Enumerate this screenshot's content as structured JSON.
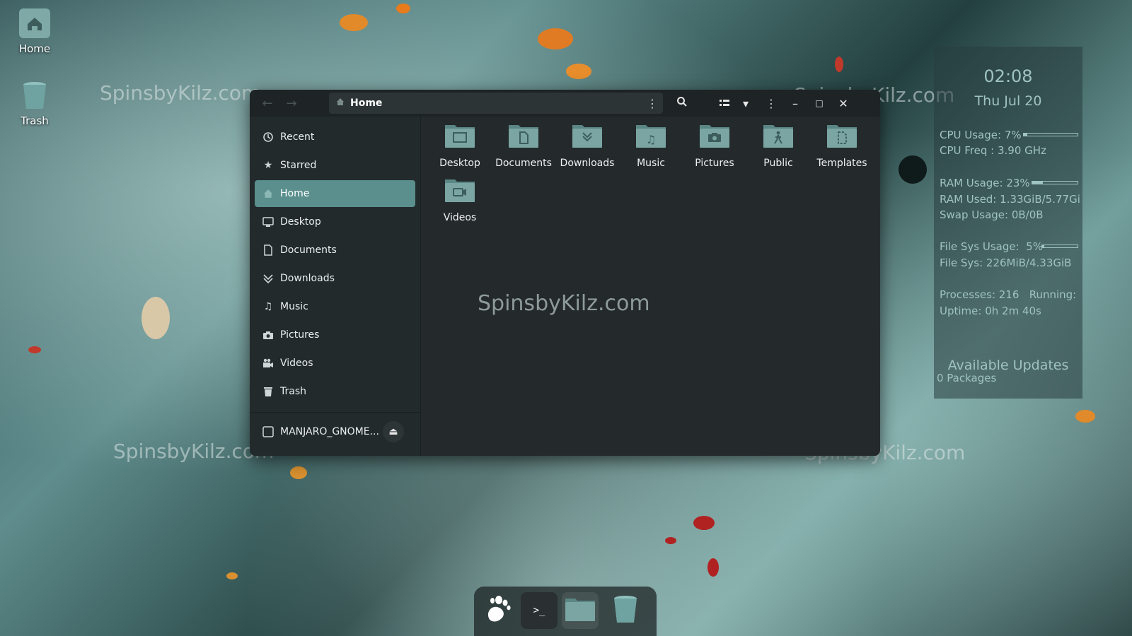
{
  "desktop": {
    "icons": [
      {
        "label": "Home",
        "icon": "home-folder-icon"
      },
      {
        "label": "Trash",
        "icon": "trash-icon"
      }
    ],
    "watermark_text": "SpinsbyKilz.com"
  },
  "file_manager": {
    "path": "Home",
    "sidebar": {
      "items": [
        {
          "label": "Recent",
          "icon": "recent-icon"
        },
        {
          "label": "Starred",
          "icon": "star-icon"
        },
        {
          "label": "Home",
          "icon": "home-icon",
          "active": true
        },
        {
          "label": "Desktop",
          "icon": "desktop-icon"
        },
        {
          "label": "Documents",
          "icon": "documents-icon"
        },
        {
          "label": "Downloads",
          "icon": "downloads-icon"
        },
        {
          "label": "Music",
          "icon": "music-icon"
        },
        {
          "label": "Pictures",
          "icon": "pictures-icon"
        },
        {
          "label": "Videos",
          "icon": "videos-icon"
        },
        {
          "label": "Trash",
          "icon": "trash-icon"
        }
      ],
      "device": {
        "label": "MANJARO_GNOME...",
        "icon": "drive-icon"
      }
    },
    "folders": [
      {
        "label": "Desktop",
        "icon": "desktop-folder-icon"
      },
      {
        "label": "Documents",
        "icon": "documents-folder-icon"
      },
      {
        "label": "Downloads",
        "icon": "downloads-folder-icon"
      },
      {
        "label": "Music",
        "icon": "music-folder-icon"
      },
      {
        "label": "Pictures",
        "icon": "pictures-folder-icon"
      },
      {
        "label": "Public",
        "icon": "public-folder-icon"
      },
      {
        "label": "Templates",
        "icon": "templates-folder-icon"
      },
      {
        "label": "Videos",
        "icon": "videos-folder-icon"
      }
    ],
    "content_watermark": "SpinsbyKilz.com"
  },
  "conky": {
    "time": "02:08",
    "date": "Thu Jul 20",
    "cpu_usage": "CPU Usage: 7%",
    "cpu_usage_fraction": 0.07,
    "cpu_freq": "CPU Freq : 3.90 GHz",
    "ram_usage": "RAM Usage: 23%",
    "ram_usage_fraction": 0.23,
    "ram_used": "RAM Used: 1.33GiB/5.77Gi",
    "swap_usage": "Swap Usage: 0B/0B",
    "fs_usage": "File Sys Usage:  5%",
    "fs_usage_fraction": 0.05,
    "fs": "File Sys: 226MiB/4.33GiB",
    "processes": "Processes: 216   Running:",
    "uptime": "Uptime: 0h 2m 40s",
    "updates_title": "Available Updates",
    "updates_count": "0 Packages"
  },
  "dock": {
    "items": [
      {
        "icon": "gnome-foot-icon"
      },
      {
        "icon": "terminal-icon"
      },
      {
        "icon": "files-icon"
      },
      {
        "icon": "trash-icon"
      }
    ]
  },
  "colors": {
    "accent": "#5a8f8d",
    "conky_text": "#9fc3c1",
    "window_bg": "#242a2c"
  }
}
